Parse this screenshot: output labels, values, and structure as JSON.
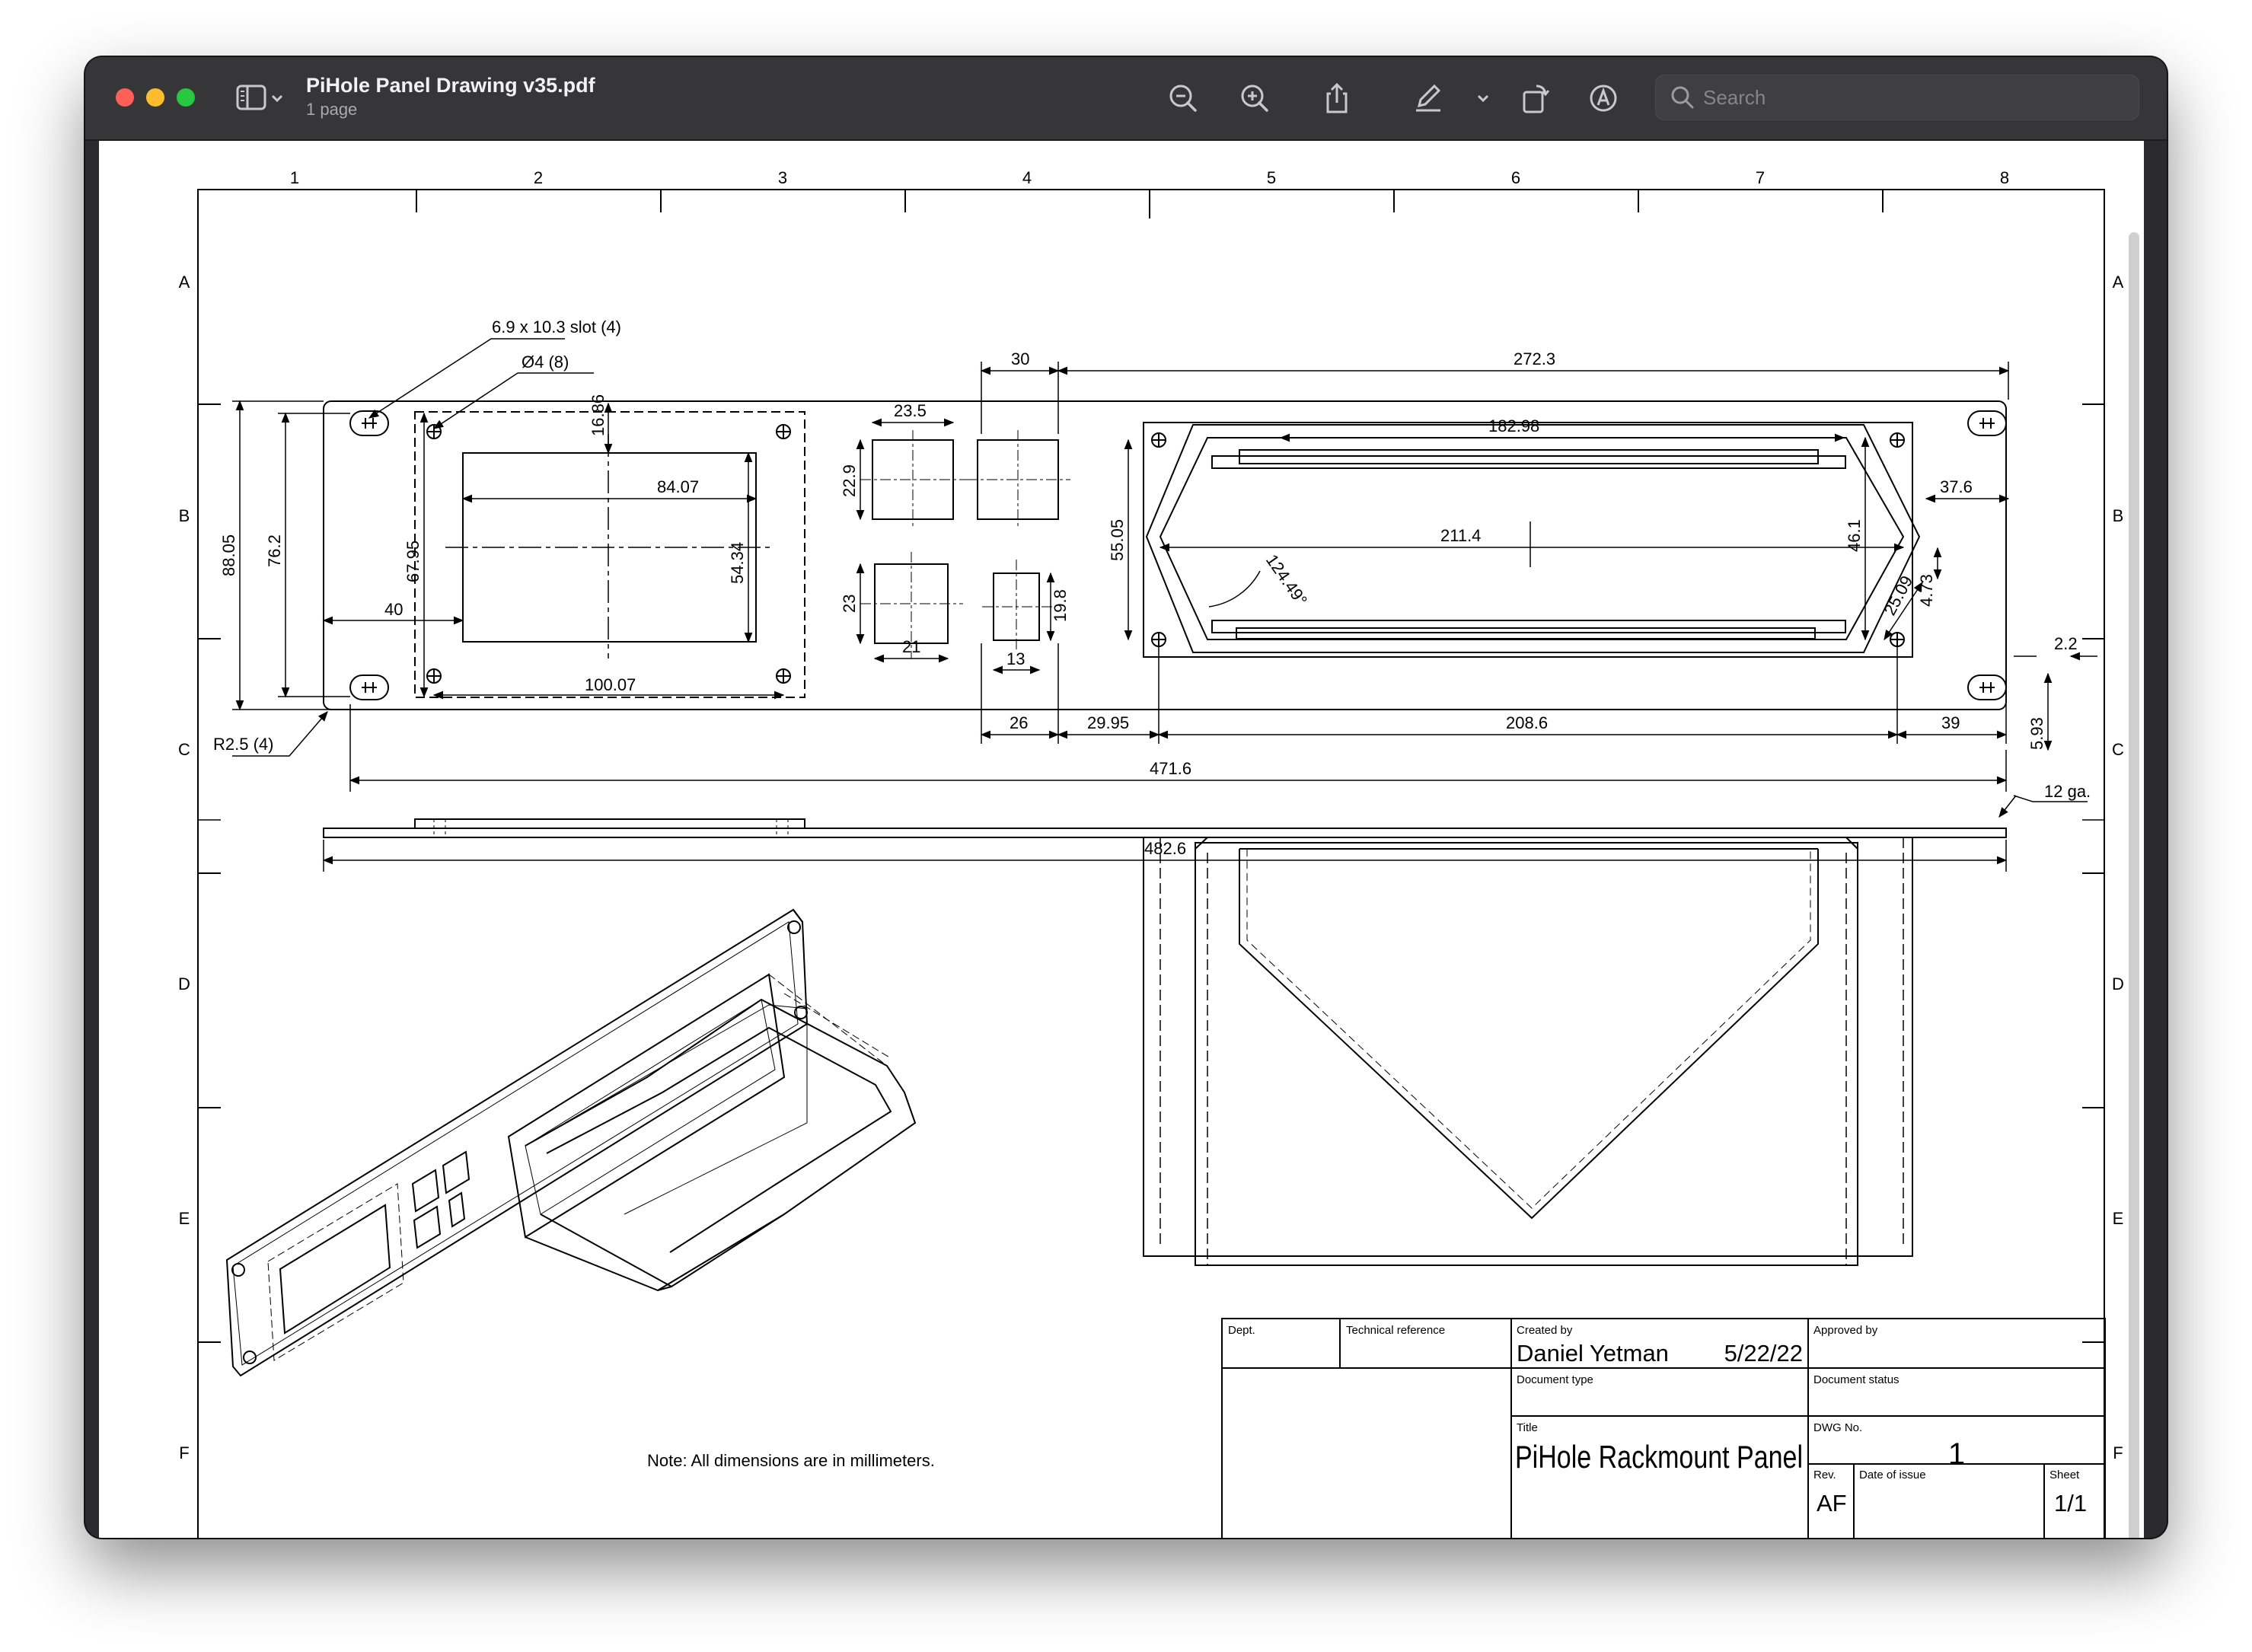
{
  "window": {
    "title": "PiHole Panel Drawing v35.pdf",
    "subtitle": "1 page"
  },
  "toolbar": {
    "search_placeholder": "Search",
    "icons": [
      "sidebar-icon",
      "chevron-down-icon",
      "zoom-out-icon",
      "zoom-in-icon",
      "share-icon",
      "markup-pen-icon",
      "chevron-down-icon",
      "rotate-icon",
      "annotate-icon",
      "search-icon"
    ]
  },
  "drawing": {
    "col_labels": [
      "1",
      "2",
      "3",
      "4",
      "5",
      "6",
      "7",
      "8"
    ],
    "row_labels": [
      "A",
      "B",
      "C",
      "D",
      "E",
      "F"
    ],
    "dims": {
      "slot": "6.9 x 10.3 slot (4)",
      "hole": "Ø4 (8)",
      "radius": "R2.5 (4)",
      "d30": "30",
      "d272_3": "272.3",
      "d23_5": "23.5",
      "d16_86": "16.86",
      "d84_07": "84.07",
      "d22_9": "22.9",
      "d182_98": "182.98",
      "d37_6": "37.6",
      "d88_05": "88.05",
      "d76_2": "76.2",
      "d67_95": "67.95",
      "d54_34": "54.34",
      "d40": "40",
      "d100_07": "100.07",
      "d23": "23",
      "d21": "21",
      "d13": "13",
      "d19_8": "19.8",
      "d55_05": "55.05",
      "d211_4": "211.4",
      "d46_1": "46.1",
      "d124_49": "124.49°",
      "d25_09": "25.09",
      "d4_73": "4.73",
      "d2_2": "2.2",
      "d26": "26",
      "d29_95": "29.95",
      "d208_6": "208.6",
      "d39": "39",
      "d5_93": "5.93",
      "d471_6": "471.6",
      "d12ga": "12 ga.",
      "d482_6": "482.6"
    },
    "note": "Note:  All dimensions are in millimeters.",
    "title_block": {
      "dept_label": "Dept.",
      "tech_ref_label": "Technical reference",
      "created_by_label": "Created by",
      "created_by": "Daniel Yetman",
      "date": "5/22/22",
      "approved_by_label": "Approved by",
      "doc_type_label": "Document type",
      "doc_status_label": "Document status",
      "title_label": "Title",
      "title": "PiHole Rackmount Panel",
      "dwg_no_label": "DWG No.",
      "dwg_no": "1",
      "rev_label": "Rev.",
      "rev": "AF",
      "date_of_issue_label": "Date of issue",
      "sheet_label": "Sheet",
      "sheet": "1/1"
    }
  }
}
